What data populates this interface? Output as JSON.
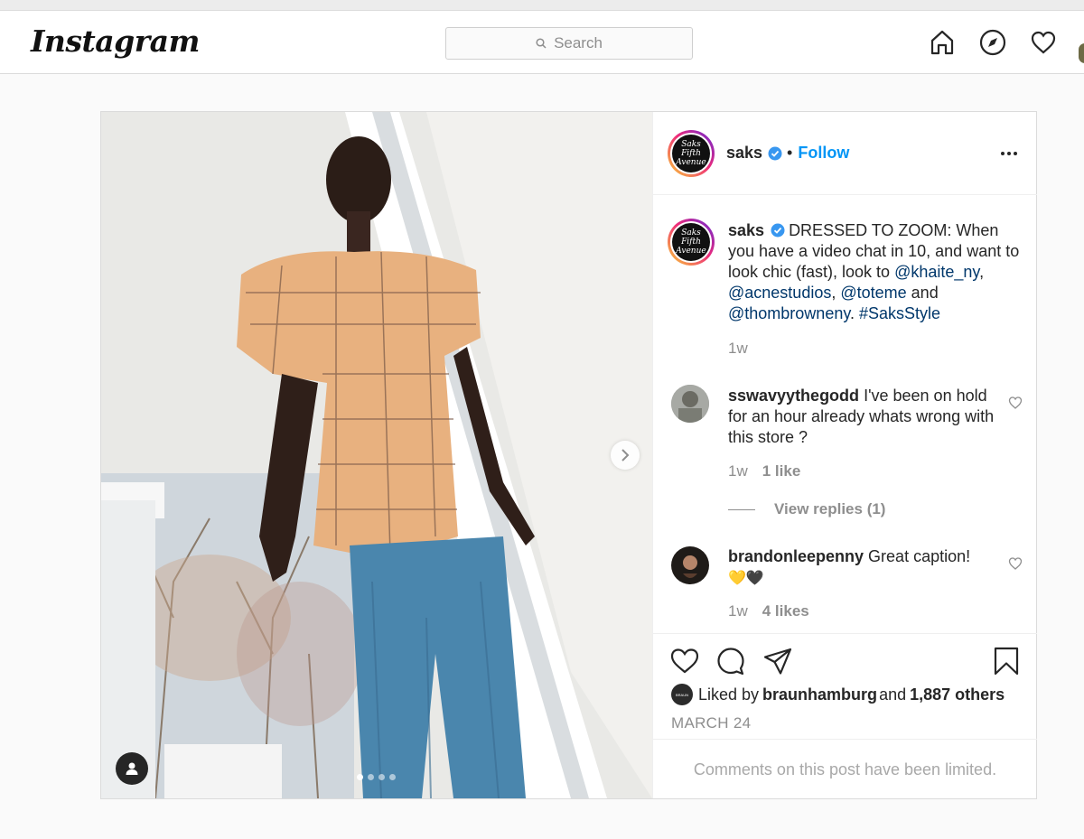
{
  "header": {
    "logo_text": "Instagram",
    "search_placeholder": "Search"
  },
  "post": {
    "author": "saks",
    "follow_label": "Follow",
    "separator": "•",
    "author_avatar_text": "Saks Fifth Avenue",
    "caption": {
      "username": "saks",
      "text_1": "DRESSED TO ZOOM: When you have a video chat in 10, and want to look chic (fast), look to ",
      "mention_1": "@khaite_ny",
      "comma_1": ", ",
      "mention_2": "@acnestudios",
      "comma_2": ", ",
      "mention_3": "@toteme",
      "and_text": " and ",
      "mention_4": "@thombrowneny",
      "period": ". ",
      "hashtag": "#SaksStyle",
      "time": "1w"
    },
    "comments": [
      {
        "username": "sswavyythegodd",
        "text": "I've been on hold for an hour already whats wrong with this store ?",
        "time": "1w",
        "likes": "1 like",
        "view_replies": "View replies (1)"
      },
      {
        "username": "brandonleepenny",
        "text": "Great caption!",
        "emojis": "💛🖤",
        "time": "1w",
        "likes": "4 likes"
      }
    ],
    "liked_by_prefix": "Liked by ",
    "liked_by_user": "braunhamburg",
    "liked_by_middle": " and ",
    "liked_by_count": "1,887 others",
    "liked_avatar_text": "BRAUN",
    "date": "MARCH 24",
    "comments_limited": "Comments on this post have been limited.",
    "carousel": {
      "total": 4,
      "active": 1
    }
  },
  "colors": {
    "link": "#00376b",
    "follow": "#0095f6",
    "verified": "#3897f0",
    "muted": "#8e8e8e"
  },
  "icons": [
    "search-icon",
    "home-icon",
    "compass-icon",
    "heart-icon",
    "verified-icon",
    "more-icon",
    "chevron-right-icon",
    "user-tag-icon",
    "comment-icon",
    "share-icon",
    "bookmark-icon"
  ]
}
